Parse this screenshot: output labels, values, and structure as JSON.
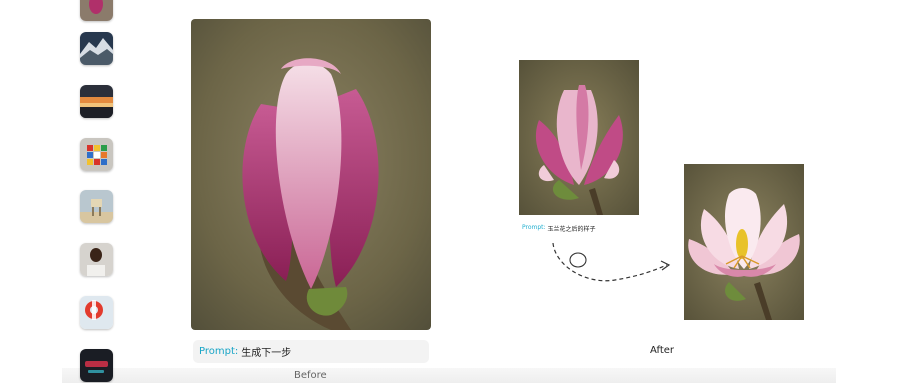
{
  "thumbnails": [
    {
      "name": "magenta-flower-thumbnail"
    },
    {
      "name": "mountain-thumbnail"
    },
    {
      "name": "sunset-thumbnail"
    },
    {
      "name": "rubiks-cube-thumbnail"
    },
    {
      "name": "lifeguard-tower-thumbnail"
    },
    {
      "name": "woman-portrait-thumbnail"
    },
    {
      "name": "lifebuoy-thumbnail"
    },
    {
      "name": "neon-sign-thumbnail"
    }
  ],
  "before": {
    "prompt_label": "Prompt:",
    "prompt_text": "生成下一步",
    "caption": "Before"
  },
  "after": {
    "prompt_label": "Prompt:",
    "prompt_text": "玉兰花之后的样子",
    "caption": "After"
  },
  "colors": {
    "accent": "#18a5c7",
    "magenta": "#b83a79",
    "pale_pink": "#f2c6d6",
    "stamen": "#e8c22a",
    "bg_olive": "#6f6a48"
  }
}
